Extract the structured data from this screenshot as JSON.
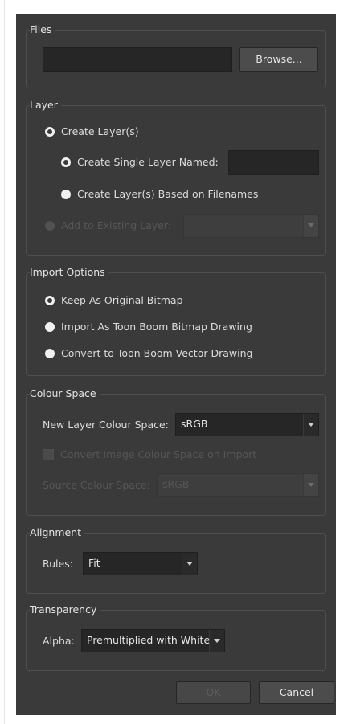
{
  "files": {
    "title": "Files",
    "path_value": "",
    "browse_label": "Browse..."
  },
  "layer": {
    "title": "Layer",
    "create_layers_label": "Create Layer(s)",
    "create_single_label": "Create Single Layer Named:",
    "single_name_value": "",
    "based_on_filenames_label": "Create Layer(s) Based on Filenames",
    "add_existing_label": "Add to Existing Layer:",
    "existing_layer_value": ""
  },
  "import_options": {
    "title": "Import Options",
    "keep_original_label": "Keep As Original Bitmap",
    "import_toon_bitmap_label": "Import As Toon Boom Bitmap Drawing",
    "convert_vector_label": "Convert to Toon Boom Vector Drawing"
  },
  "colour_space": {
    "title": "Colour Space",
    "new_layer_label": "New Layer Colour Space:",
    "new_layer_value": "sRGB",
    "convert_on_import_label": "Convert Image Colour Space on Import",
    "source_label": "Source Colour Space:",
    "source_value": "sRGB"
  },
  "alignment": {
    "title": "Alignment",
    "rules_label": "Rules:",
    "rules_value": "Fit"
  },
  "transparency": {
    "title": "Transparency",
    "alpha_label": "Alpha:",
    "alpha_value": "Premultiplied with White"
  },
  "buttons": {
    "ok_label": "OK",
    "cancel_label": "Cancel"
  }
}
